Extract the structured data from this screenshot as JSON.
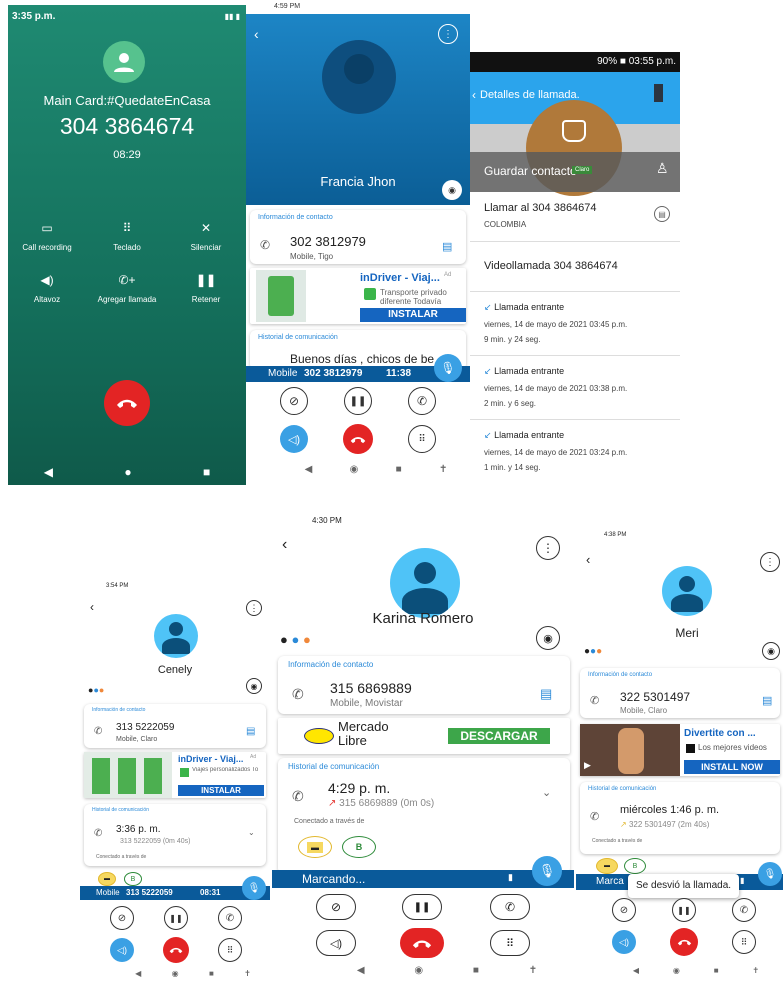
{
  "p1": {
    "status_time": "3:35 p.m.",
    "card_label": "Main Card:#QuedateEnCasa",
    "number": "304 3864674",
    "duration": "08:29",
    "controls": [
      "Call recording",
      "Teclado",
      "Silenciar",
      "Altavoz",
      "Agregar llamada",
      "Retener"
    ]
  },
  "p2": {
    "status_time": "4:59 PM",
    "contact_name": "Francia Jhon",
    "info_header": "Información de contacto",
    "phone": "302 3812979",
    "phone_sub": "Mobile, Tigo",
    "ad_title": "inDriver - Viaj...",
    "ad_badge": "Ad",
    "ad_desc": "Transporte privado diferente Todavía",
    "ad_button": "INSTALAR",
    "history_header": "Historial de comunicación",
    "history_text": "Buenos días , chicos de be",
    "bar_label": "Mobile",
    "bar_number": "302 3812979",
    "bar_time": "11:38"
  },
  "p3": {
    "status_text": "90% ■ 03:55 p.m.",
    "title": "Detalles de llamada.",
    "save_contact": "Guardar contacto",
    "claro_tag": "Claro",
    "call_to": "Llamar al 304 3864674",
    "country": "COLOMBIA",
    "video_call": "Videollamada 304 3864674",
    "entries": [
      {
        "type": "Llamada entrante",
        "date": "viernes, 14 de mayo de 2021 03:45 p.m.",
        "dur": "9 min. y 24 seg."
      },
      {
        "type": "Llamada entrante",
        "date": "viernes, 14 de mayo de 2021 03:38 p.m.",
        "dur": "2 min. y 6 seg."
      },
      {
        "type": "Llamada entrante",
        "date": "viernes, 14 de mayo de 2021 03:24 p.m.",
        "dur": "1 min. y 14 seg."
      }
    ]
  },
  "p4": {
    "status_time": "3:54 PM",
    "contact_name": "Cenely",
    "info_header": "Información de contacto",
    "phone": "313 5222059",
    "phone_sub": "Mobile, Claro",
    "ad_title": "inDriver - Viaj...",
    "ad_badge": "Ad",
    "ad_desc": "Viajes personalizados To",
    "ad_button": "INSTALAR",
    "history_header": "Historial de comunicación",
    "hist_time": "3:36 p. m.",
    "hist_detail": "313 5222059 (0m 40s)",
    "connected": "Conectado a través de",
    "bar_label": "Mobile",
    "bar_number": "313 5222059",
    "bar_time": "08:31"
  },
  "p5": {
    "status_time": "4:30 PM",
    "contact_name": "Karina Romero",
    "info_header": "Información de contacto",
    "phone": "315 6869889",
    "phone_sub": "Mobile, Movistar",
    "ad_brand": "Mercado Libre",
    "ad_button": "DESCARGAR",
    "history_header": "Historial de comunicación",
    "hist_time": "4:29 p. m.",
    "hist_detail": "315 6869889 (0m 0s)",
    "connected": "Conectado a través de",
    "bar_label": "Marcando..."
  },
  "p6": {
    "status_time": "4:38 PM",
    "contact_name": "Meri",
    "info_header": "Información de contacto",
    "phone": "322 5301497",
    "phone_sub": "Mobile, Claro",
    "ad_title": "Divertite con ...",
    "ad_desc": "Los mejores videos",
    "ad_button": "INSTALL NOW",
    "history_header": "Historial de comunicación",
    "hist_time": "miércoles 1:46 p. m.",
    "hist_detail": "322 5301497 (2m 40s)",
    "connected": "Conectado a través de",
    "bar_label": "Marca",
    "toast": "Se desvió la llamada."
  }
}
